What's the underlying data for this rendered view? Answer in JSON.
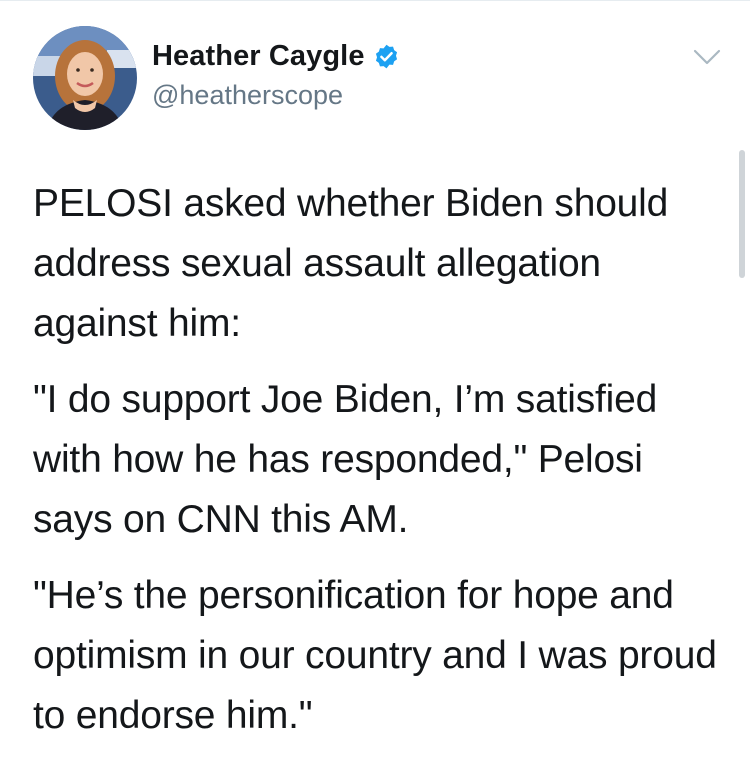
{
  "tweet": {
    "author": {
      "name": "Heather Caygle",
      "handle": "@heatherscope",
      "verified": true
    },
    "paragraphs": [
      "PELOSI asked whether Biden should address sexual assault allegation against him:",
      "\"I do support Joe Biden, I’m satisfied with how he has responded,\" Pelosi says on CNN this AM.",
      "\"He’s the personification for hope and optimism in our country and I was proud to endorse him.\""
    ]
  },
  "icons": {
    "verified": "verified-badge-icon",
    "menu": "chevron-down-icon"
  },
  "colors": {
    "text": "#14171a",
    "handle": "#657786",
    "verified": "#1da1f2",
    "chevron": "#aab8c2"
  }
}
